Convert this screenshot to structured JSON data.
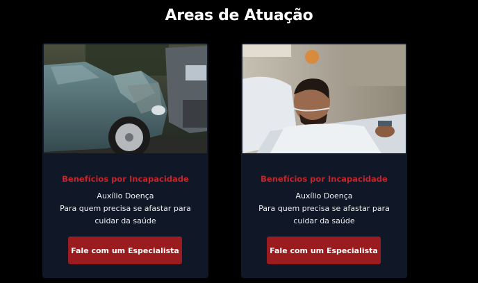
{
  "section": {
    "title": "Areas de Atuação"
  },
  "cards": [
    {
      "image": "car-crash-photo",
      "title": "Benefícios por Incapacidade",
      "subtitle": "Auxílio Doença",
      "description": "Para quem precisa se afastar para cuidar da saúde",
      "button_label": "Fale com um Especialista"
    },
    {
      "image": "hospital-patient-photo",
      "title": "Benefícios por Incapacidade",
      "subtitle": "Auxílio Doença",
      "description": "Para quem precisa se afastar para cuidar da saúde",
      "button_label": "Fale com um Especialista"
    }
  ],
  "colors": {
    "background": "#000000",
    "card": "#101828",
    "accent_text": "#c0262b",
    "button": "#9b1c1f"
  }
}
